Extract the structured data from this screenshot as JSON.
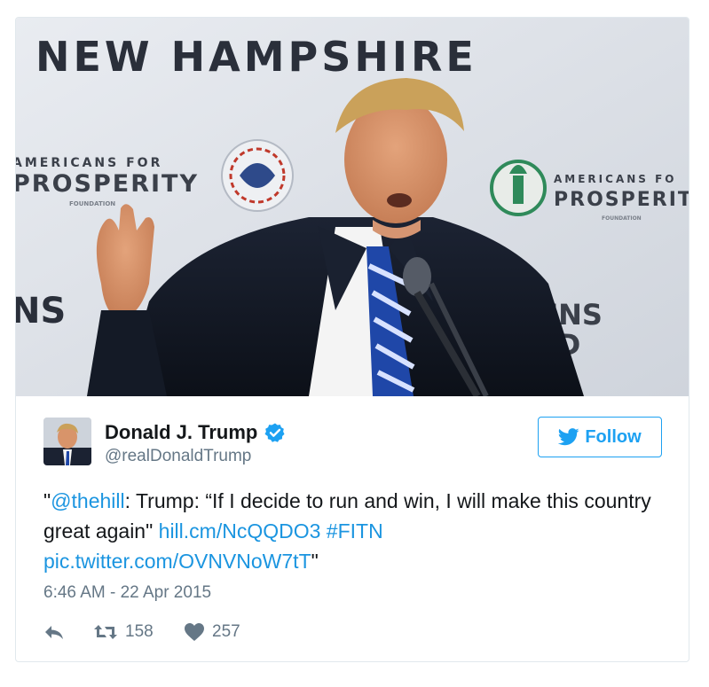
{
  "media": {
    "banner_text_top": "NEW HAMPSHIRE",
    "banner_text_left_small": "AMERICANS FOR",
    "banner_text_left_big": "PROSPERITY",
    "banner_text_left_tiny": "FOUNDATION",
    "banner_text_right_small": "AMERICANS FO",
    "banner_text_right_big": "PROSPERIT",
    "banner_text_right_tiny": "FOUNDATION",
    "banner_text_bottom_left": "NS",
    "banner_text_bottom_right_1": "ZENS",
    "banner_text_bottom_right_2": "TED"
  },
  "user": {
    "name": "Donald J. Trump",
    "handle": "@realDonaldTrump",
    "avatar_icon": "profile-photo"
  },
  "follow_button": {
    "label": "Follow",
    "icon": "twitter-bird-icon"
  },
  "tweet": {
    "quote_open": "\"",
    "mention": "@thehill",
    "text_main": ": Trump: “If I decide to run and win, I will make this country great again\" ",
    "link": "hill.cm/NcQQDO3",
    "space": " ",
    "hashtag": "#FITN",
    "pic_link": "pic.twitter.com/OVNVNoW7tT",
    "quote_close": "\""
  },
  "timestamp": "6:46 AM - 22 Apr 2015",
  "actions": {
    "reply_icon": "reply-icon",
    "retweet_icon": "retweet-icon",
    "retweet_count": "158",
    "like_icon": "heart-icon",
    "like_count": "257"
  },
  "colors": {
    "accent": "#1da1f2",
    "link": "#1b95e0",
    "text": "#14171a",
    "muted": "#657786",
    "border": "#e1e8ed"
  }
}
